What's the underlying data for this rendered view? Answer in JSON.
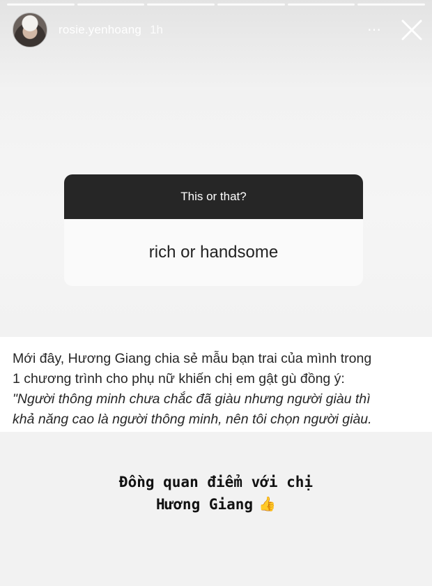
{
  "story": {
    "progress_segments": 6,
    "header": {
      "username": "rosie.yenhoang",
      "time": "1h",
      "more_icon": "⋯",
      "close_icon": "close-icon"
    },
    "question_card": {
      "title": "This or that?",
      "answer": "rich or handsome"
    },
    "caption": {
      "text_line1": "Mới đây, Hương Giang chia sẻ mẫu bạn trai của mình trong",
      "text_line2": "1 chương trình cho phụ nữ khiến chị em gật gù đồng ý:",
      "quote_line1": "\"Người thông minh chưa chắc đã giàu nhưng người giàu thì",
      "quote_line2": "khả năng cao là người thông minh, nên tôi chọn người giàu."
    },
    "story_text": {
      "line1": "Đồng quan điểm với chị",
      "line2": "Hương Giang",
      "emoji": "👍"
    }
  },
  "colors": {
    "card_header": "#262626",
    "card_body": "#fafafa",
    "emoji": "#f5b73a"
  }
}
